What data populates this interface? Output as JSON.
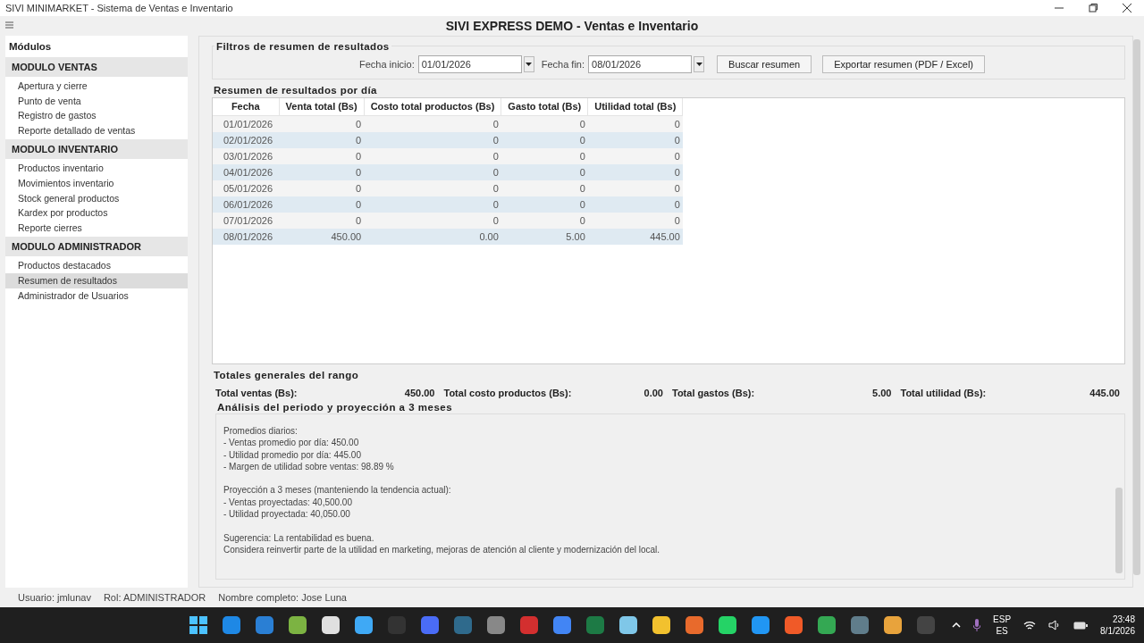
{
  "window": {
    "title": "SIVI MINIMARKET - Sistema de Ventas e Inventario",
    "heading": "SIVI EXPRESS DEMO - Ventas e Inventario"
  },
  "sidebar": {
    "title": "Módulos",
    "sections": [
      {
        "title": "MODULO VENTAS",
        "items": [
          {
            "label": "Apertura y cierre",
            "selected": false
          },
          {
            "label": "Punto de venta",
            "selected": false
          },
          {
            "label": "Registro de gastos",
            "selected": false
          },
          {
            "label": "Reporte detallado de ventas",
            "selected": false
          }
        ]
      },
      {
        "title": "MODULO INVENTARIO",
        "items": [
          {
            "label": "Productos inventario",
            "selected": false
          },
          {
            "label": "Movimientos inventario",
            "selected": false
          },
          {
            "label": "Stock general productos",
            "selected": false
          },
          {
            "label": "Kardex por productos",
            "selected": false
          },
          {
            "label": "Reporte cierres",
            "selected": false
          }
        ]
      },
      {
        "title": "MODULO ADMINISTRADOR",
        "items": [
          {
            "label": "Productos destacados",
            "selected": false
          },
          {
            "label": "Resumen de resultados",
            "selected": true
          },
          {
            "label": "Administrador de Usuarios",
            "selected": false
          }
        ]
      }
    ]
  },
  "filters": {
    "title": "Filtros de resumen de resultados",
    "fields": [
      {
        "label": "Fecha inicio:",
        "value": "01/01/2026"
      },
      {
        "label": "Fecha fin:",
        "value": "08/01/2026"
      }
    ],
    "buttons": [
      "Buscar resumen",
      "Exportar resumen (PDF / Excel)"
    ]
  },
  "table": {
    "title": "Resumen de resultados por día",
    "columns": [
      "Fecha",
      "Venta total (Bs)",
      "Costo total productos (Bs)",
      "Gasto total (Bs)",
      "Utilidad total (Bs)"
    ],
    "rows": [
      [
        "01/01/2026",
        "0",
        "0",
        "0",
        "0"
      ],
      [
        "02/01/2026",
        "0",
        "0",
        "0",
        "0"
      ],
      [
        "03/01/2026",
        "0",
        "0",
        "0",
        "0"
      ],
      [
        "04/01/2026",
        "0",
        "0",
        "0",
        "0"
      ],
      [
        "05/01/2026",
        "0",
        "0",
        "0",
        "0"
      ],
      [
        "06/01/2026",
        "0",
        "0",
        "0",
        "0"
      ],
      [
        "07/01/2026",
        "0",
        "0",
        "0",
        "0"
      ],
      [
        "08/01/2026",
        "450.00",
        "0.00",
        "5.00",
        "445.00"
      ]
    ]
  },
  "totals": {
    "title": "Totales generales del rango",
    "items": [
      {
        "label": "Total ventas (Bs):",
        "value": "450.00"
      },
      {
        "label": "Total costo productos (Bs):",
        "value": "0.00"
      },
      {
        "label": "Total gastos (Bs):",
        "value": "5.00"
      },
      {
        "label": "Total utilidad (Bs):",
        "value": "445.00"
      }
    ]
  },
  "analysis": {
    "title": "Análisis del periodo y proyección a 3 meses",
    "paragraphs": [
      [
        "Promedios diarios:",
        "- Ventas promedio por día: 450.00",
        "- Utilidad promedio por día: 445.00",
        "- Margen de utilidad sobre ventas: 98.89 %"
      ],
      [
        "Proyección a 3 meses (manteniendo la tendencia actual):",
        "- Ventas proyectadas: 40,500.00",
        "- Utilidad proyectada: 40,050.00"
      ],
      [
        "Sugerencia: La rentabilidad es buena.",
        "Considera reinvertir parte de la utilidad en marketing, mejoras de atención al cliente y modernización del local."
      ]
    ]
  },
  "status_bar": [
    "Usuario: jmlunav",
    "Rol: ADMINISTRADOR",
    "Nombre completo: Jose Luna"
  ],
  "taskbar": {
    "language": [
      "ESP",
      "ES"
    ],
    "time": "23:48",
    "date": "8/1/2026"
  }
}
